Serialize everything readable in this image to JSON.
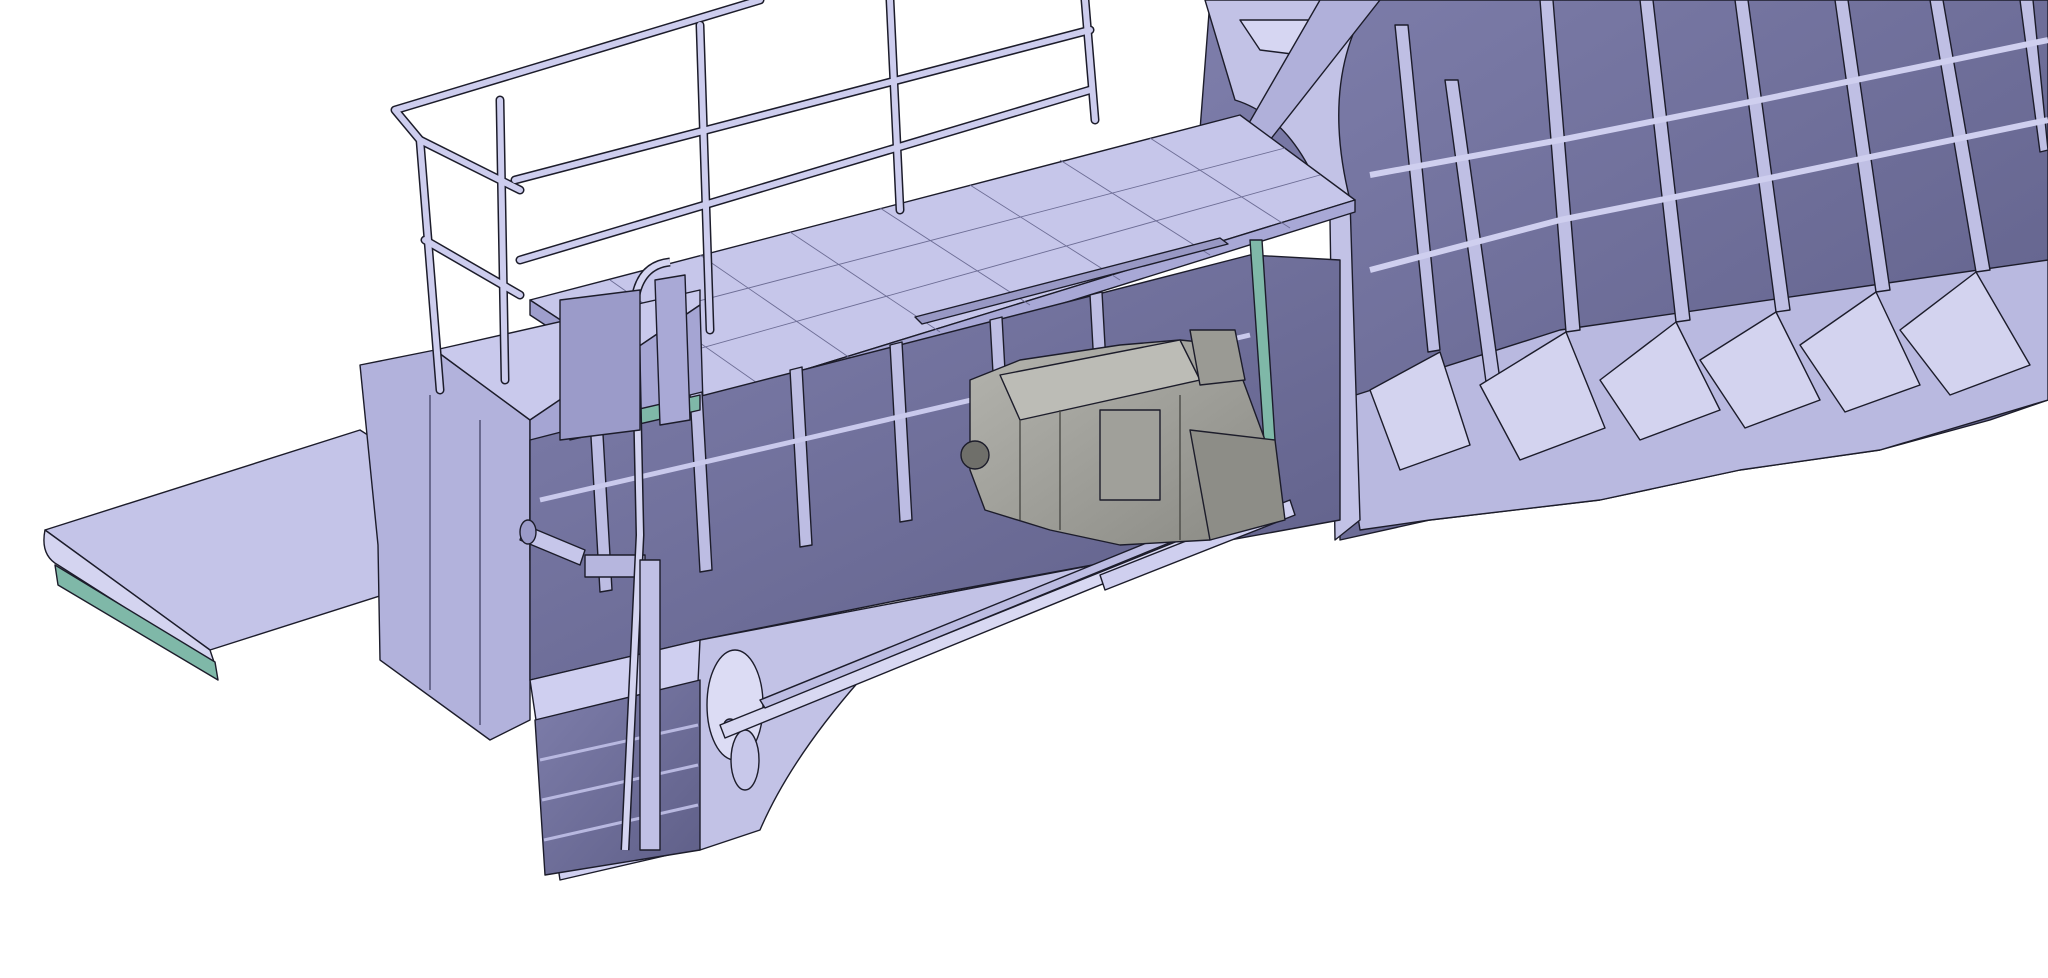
{
  "viewport": {
    "background": "#ffffff",
    "colors": {
      "hull_light": "#c9c9ea",
      "hull_mid": "#b2b2dc",
      "hull_dark": "#8b8bb7",
      "hull_shadow": "#6f6f98",
      "edge": "#1c1c2a",
      "trim_green": "#7fb8a8",
      "engine": "#a6a6a0",
      "engine_dark": "#7d7d78"
    },
    "parts": {
      "railing": "railing-icon",
      "deck": "deck-plate-icon",
      "transom_platform": "swim-platform-icon",
      "hull_frames": "hull-frame-icon",
      "bulkhead": "bulkhead-icon",
      "engine": "engine-icon",
      "shaft": "propeller-shaft-icon",
      "propeller": "propeller-icon",
      "rudder": "rudder-icon",
      "skeg": "skeg-icon",
      "ladder": "ladder-icon",
      "hydraulic_cylinder": "hydraulic-cylinder-icon"
    }
  }
}
